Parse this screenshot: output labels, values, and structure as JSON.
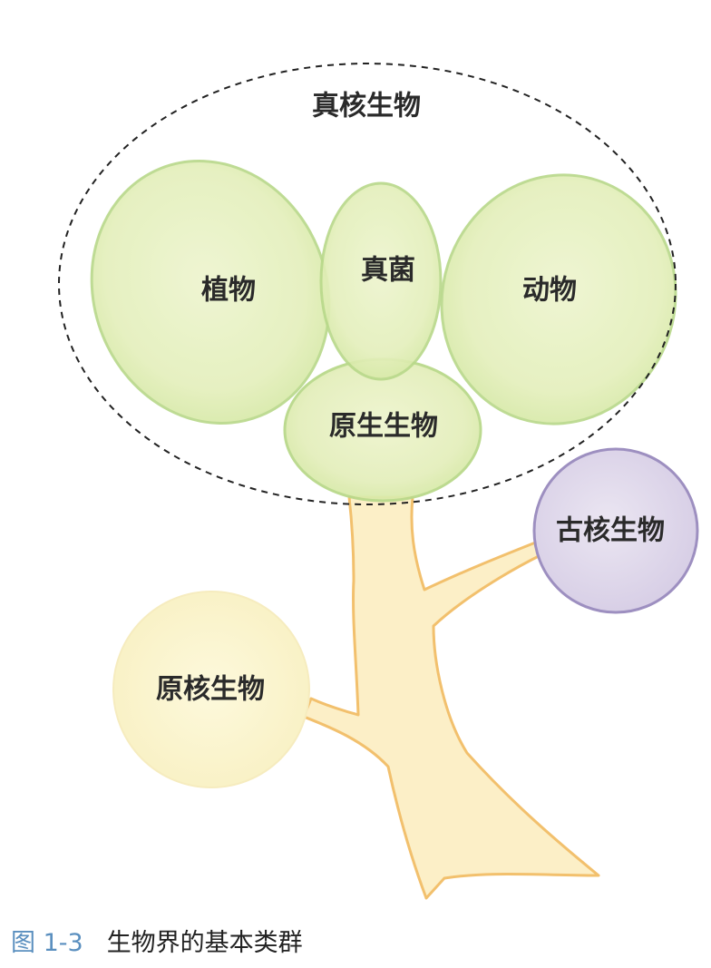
{
  "diagram": {
    "eukaryote_group_label": "真核生物",
    "plants_label": "植物",
    "fungi_label": "真菌",
    "animals_label": "动物",
    "protists_label": "原生生物",
    "archaea_label": "古核生物",
    "prokaryote_label": "原核生物"
  },
  "caption": {
    "figure_number": "图 1-3",
    "title": "生物界的基本类群"
  },
  "colors": {
    "green_fill": "#e6f0bf",
    "green_stroke": "#b9d98b",
    "archaea_fill": "#e2dcec",
    "archaea_stroke": "#9d8fc0",
    "prokaryote_fill": "#fbf5cf",
    "trunk_fill": "#fcefc7",
    "trunk_stroke": "#f2c06d",
    "caption_accent": "#5a8fbf"
  }
}
